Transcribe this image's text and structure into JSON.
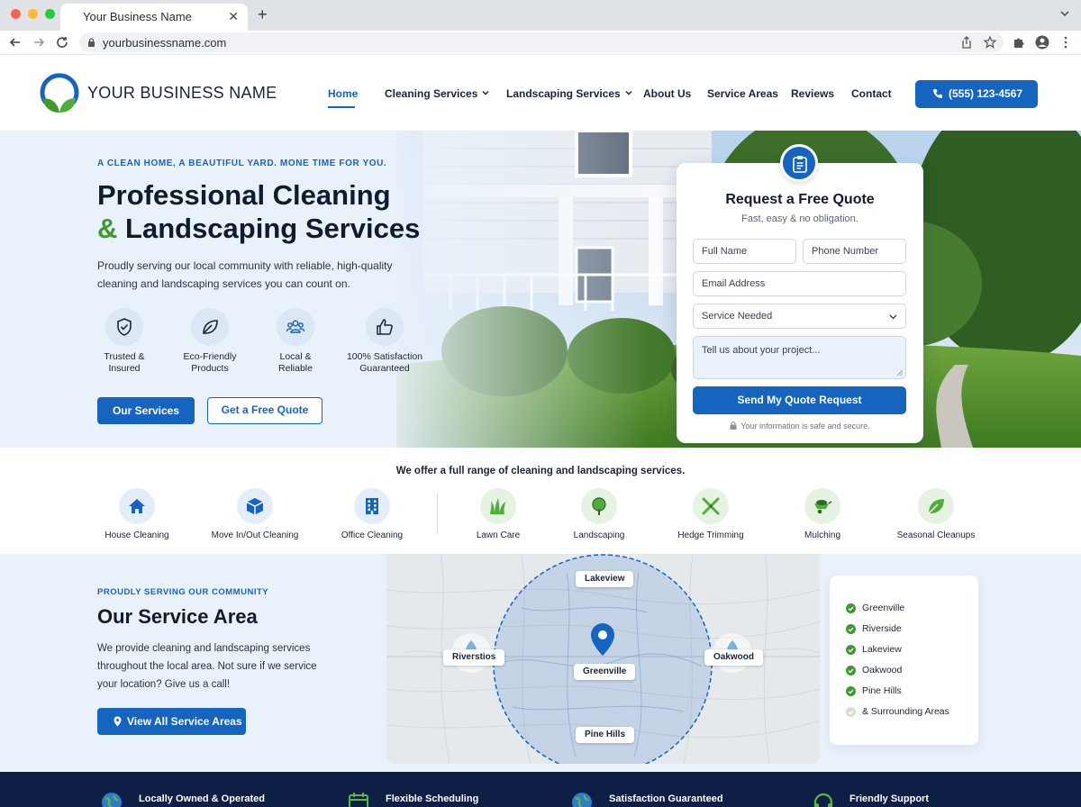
{
  "browser": {
    "tab_title": "Your Business Name",
    "url": "yourbusinessname.com"
  },
  "header": {
    "logo_text": "YOUR BUSINESS NAME",
    "nav": [
      {
        "label": "Home",
        "active": true
      },
      {
        "label": "Cleaning Services",
        "dropdown": true
      },
      {
        "label": "Landscaping Services",
        "dropdown": true
      },
      {
        "label": "About Us"
      },
      {
        "label": "Service Areas"
      },
      {
        "label": "Reviews"
      },
      {
        "label": "Contact"
      }
    ],
    "phone": "(555) 123-4567"
  },
  "hero": {
    "eyebrow": "A CLEAN HOME, A BEAUTIFUL YARD. MONE TIME FOR YOU.",
    "title_line1": "Professional Cleaning",
    "title_amp": "&",
    "title_line2": "Landscaping Services",
    "description": "Proudly serving our local community with reliable, high-quality cleaning and landscaping services you can count on.",
    "features": [
      {
        "icon": "shield-check-icon",
        "line1": "Trusted &",
        "line2": "Insured"
      },
      {
        "icon": "leaf-icon",
        "line1": "Eco-Friendly",
        "line2": "Products"
      },
      {
        "icon": "people-icon",
        "line1": "Local &",
        "line2": "Reliable"
      },
      {
        "icon": "thumbs-up-icon",
        "line1": "100% Satisfaction",
        "line2": "Guaranteed"
      }
    ],
    "primary_button": "Our Services",
    "secondary_button": "Get a Free Quote"
  },
  "quote": {
    "title": "Request a Free Quote",
    "subtitle": "Fast, easy & no obligation.",
    "full_name_placeholder": "Full Name",
    "phone_placeholder": "Phone Number",
    "email_placeholder": "Email Address",
    "service_selected": "Service Needed",
    "project_placeholder": "Tell us about your project...",
    "submit": "Send My Quote Request",
    "secure_note": "Your information is safe and secure."
  },
  "services": {
    "heading": "We offer a full range of cleaning and landscaping services.",
    "items": [
      {
        "label": "House Cleaning",
        "icon": "house-icon"
      },
      {
        "label": "Move In/Out Cleaning",
        "icon": "box-icon"
      },
      {
        "label": "Office Cleaning",
        "icon": "office-building-icon"
      },
      {
        "label": "Lawn Care",
        "icon": "grass-icon"
      },
      {
        "label": "Landscaping",
        "icon": "tree-icon"
      },
      {
        "label": "Hedge Trimming",
        "icon": "shears-icon"
      },
      {
        "label": "Mulching",
        "icon": "wheelbarrow-icon"
      },
      {
        "label": "Seasonal Cleanups",
        "icon": "leaf-icon"
      }
    ]
  },
  "service_area": {
    "eyebrow": "PROUDLY SERVING OUR COMMUNITY",
    "title": "Our Service Area",
    "description": "We provide cleaning and landscaping services throughout the local area. Not sure if we service your location? Give us a call!",
    "button": "View All Service Areas",
    "map_labels": {
      "north": "Lakeview",
      "west": "Riverstios",
      "center": "Greenville",
      "east": "Oakwood",
      "south": "Pine Hills"
    },
    "list": [
      {
        "label": "Greenville",
        "checked": true
      },
      {
        "label": "Riverside",
        "checked": true
      },
      {
        "label": "Lakeview",
        "checked": true
      },
      {
        "label": "Oakwood",
        "checked": true
      },
      {
        "label": "Pine Hills",
        "checked": true
      },
      {
        "label": "& Surrounding Areas",
        "checked": false
      }
    ]
  },
  "footer_strip": [
    {
      "label": "Locally Owned & Operated",
      "icon": "globe-icon"
    },
    {
      "label": "Flexible Scheduling",
      "icon": "calendar-icon"
    },
    {
      "label": "Satisfaction Guaranteed",
      "icon": "globe-icon"
    },
    {
      "label": "Friendly Support",
      "icon": "headset-icon"
    }
  ],
  "colors": {
    "brand_blue": "#1565c0",
    "brand_green": "#3c9a2e",
    "navy": "#0d1f45",
    "hero_bg": "#e9f1fb"
  }
}
